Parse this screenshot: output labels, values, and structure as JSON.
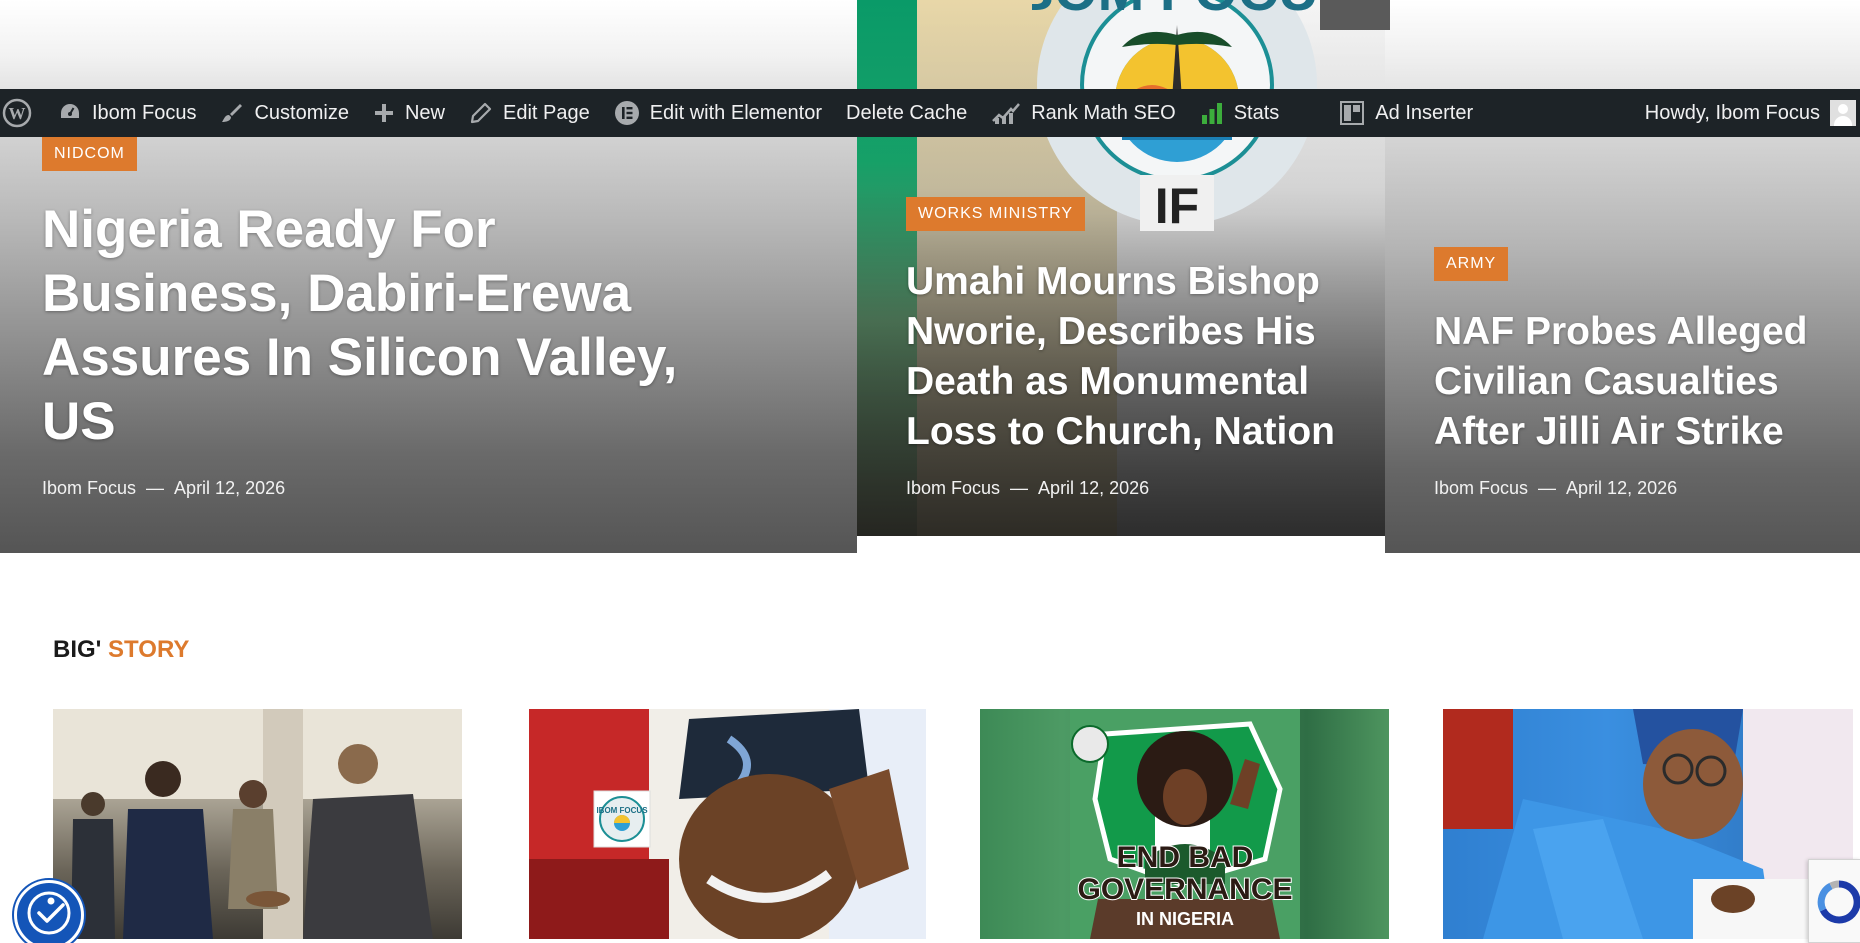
{
  "admin_bar": {
    "wp_logo_icon": "wordpress-icon",
    "site_name": "Ibom Focus",
    "customize": "Customize",
    "new": "New",
    "edit_page": "Edit Page",
    "edit_with_elementor": "Edit with Elementor",
    "delete_cache": "Delete Cache",
    "rank_math_seo": "Rank Math SEO",
    "stats": "Stats",
    "ad_inserter": "Ad Inserter",
    "howdy": "Howdy, Ibom Focus"
  },
  "hero": {
    "logo_text": "IBOM FOCUS",
    "logo_badge": "IF",
    "articles": [
      {
        "category": "NIDCOM",
        "title": "Nigeria Ready For Business, Dabiri-Erewa Assures In Silicon Valley, US",
        "author": "Ibom Focus",
        "separator": "—",
        "date": "April 12, 2026"
      },
      {
        "category": "WORKS MINISTRY",
        "title": "Umahi Mourns Bishop Nworie, Describes His Death as Monumental Loss to Church, Nation",
        "author": "Ibom Focus",
        "separator": "—",
        "date": "April 12, 2026"
      },
      {
        "category": "ARMY",
        "title": "NAF Probes Alleged Civilian Casualties After Jilli Air Strike",
        "author": "Ibom Focus",
        "separator": "—",
        "date": "April 12, 2026"
      }
    ]
  },
  "big_story": {
    "title_part1": "BIG'",
    "title_part2": " STORY",
    "card3_text1": "END BAD",
    "card3_text2": "GOVERNANCE",
    "card3_text3": "IN NIGERIA",
    "card2_badge": "IBOM FOCUS"
  },
  "colors": {
    "accent": "#dd7a2d",
    "admin_bar": "#1d2327",
    "accessibility": "#1455b8"
  }
}
